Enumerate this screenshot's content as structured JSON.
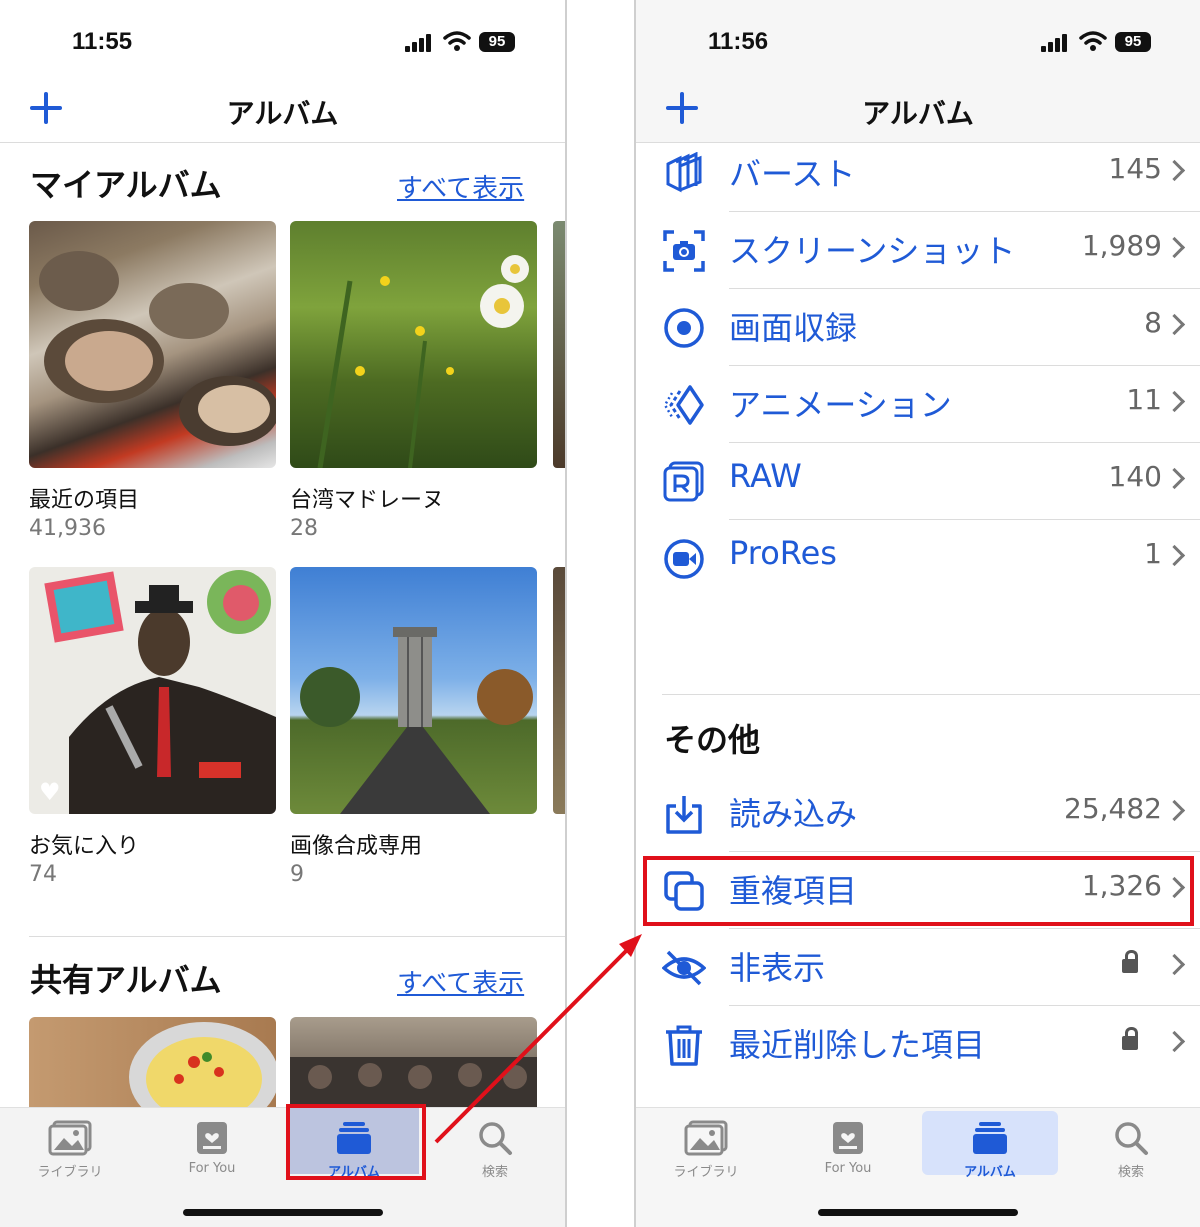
{
  "left_screen": {
    "status": {
      "time": "11:55",
      "battery": "95"
    },
    "nav": {
      "title": "アルバム"
    },
    "my_albums": {
      "title": "マイアルバム",
      "see_all": "すべて表示",
      "items": [
        {
          "name": "最近の項目",
          "count": "41,936"
        },
        {
          "name": "台湾マドレーヌ",
          "count": "28"
        },
        {
          "name": "お気に入り",
          "count": "74"
        },
        {
          "name": "画像合成専用",
          "count": "9"
        }
      ]
    },
    "shared_albums": {
      "title": "共有アルバム",
      "see_all": "すべて表示"
    },
    "tabs": [
      {
        "label": "ライブラリ",
        "icon": "photo-library-icon"
      },
      {
        "label": "For You",
        "icon": "for-you-icon"
      },
      {
        "label": "アルバム",
        "icon": "albums-icon",
        "active": true
      },
      {
        "label": "検索",
        "icon": "search-icon"
      }
    ]
  },
  "right_screen": {
    "status": {
      "time": "11:56",
      "battery": "95"
    },
    "nav": {
      "title": "アルバム"
    },
    "media_types": [
      {
        "label": "バースト",
        "count": "145",
        "icon": "burst-icon"
      },
      {
        "label": "スクリーンショット",
        "count": "1,989",
        "icon": "screenshot-icon"
      },
      {
        "label": "画面収録",
        "count": "8",
        "icon": "screen-recording-icon"
      },
      {
        "label": "アニメーション",
        "count": "11",
        "icon": "animation-icon"
      },
      {
        "label": "RAW",
        "count": "140",
        "icon": "raw-icon"
      },
      {
        "label": "ProRes",
        "count": "1",
        "icon": "prores-icon"
      }
    ],
    "other": {
      "title": "その他",
      "items": [
        {
          "label": "読み込み",
          "count": "25,482",
          "icon": "import-icon"
        },
        {
          "label": "重複項目",
          "count": "1,326",
          "icon": "duplicates-icon"
        },
        {
          "label": "非表示",
          "icon": "hidden-eye-icon",
          "locked": true
        },
        {
          "label": "最近削除した項目",
          "icon": "trash-icon",
          "locked": true
        }
      ]
    },
    "tabs": [
      {
        "label": "ライブラリ",
        "icon": "photo-library-icon"
      },
      {
        "label": "For You",
        "icon": "for-you-icon"
      },
      {
        "label": "アルバム",
        "icon": "albums-icon",
        "active": true
      },
      {
        "label": "検索",
        "icon": "search-icon"
      }
    ]
  },
  "colors": {
    "accent": "#1f5ad6",
    "highlight": "#e0101a"
  }
}
